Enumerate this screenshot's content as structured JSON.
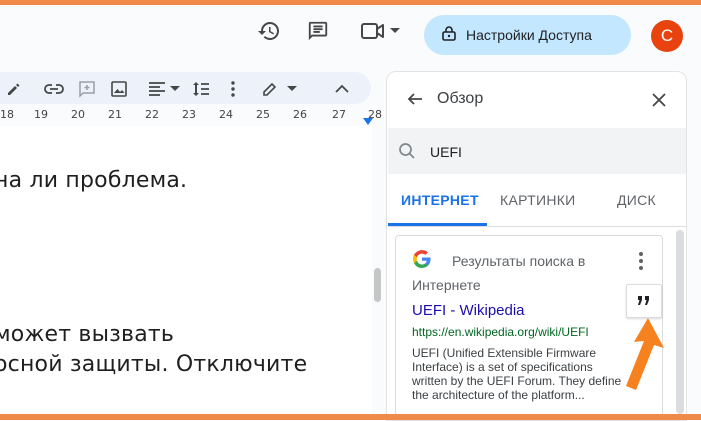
{
  "header": {
    "share_label": "Настройки Доступа",
    "avatar_letter": "C",
    "icons": [
      "history-icon",
      "comment-icon",
      "video-call-icon",
      "chevron-down-icon",
      "lock-icon"
    ]
  },
  "toolbar": {
    "icons": [
      "highlight-pen-icon",
      "link-icon",
      "add-comment-icon",
      "image-icon",
      "align-left-icon",
      "chevron-down-icon",
      "line-spacing-icon",
      "more-vert-icon",
      "edit-mode-icon",
      "chevron-down-icon",
      "chevron-up-icon"
    ]
  },
  "ruler": {
    "labels": [
      "18",
      "19",
      "20",
      "21",
      "22",
      "23",
      "24",
      "25",
      "26",
      "27",
      "28"
    ]
  },
  "document": {
    "lines": [
      "на ли проблема.",
      "может вызвать",
      "осной защиты. Отключите"
    ]
  },
  "panel": {
    "title": "Обзор",
    "search_value": "UEFI",
    "tabs": [
      {
        "label": "ИНТЕРНЕТ",
        "active": true
      },
      {
        "label": "КАРТИНКИ",
        "active": false
      },
      {
        "label": "ДИСК",
        "active": false
      }
    ],
    "card": {
      "heading_line1": "Результаты поиска в",
      "heading_line2": "Интернете",
      "result_title": "UEFI - Wikipedia",
      "result_url": "https://en.wikipedia.org/wiki/UEFI",
      "result_snippet": "UEFI (Unified Extensible Firmware Interface) is a set of specifications written by the UEFI Forum. They define the architecture of the platform..."
    }
  },
  "colors": {
    "accent": "#1a73e8",
    "share_bg": "#c2e7ff",
    "avatar_bg": "#e8430f",
    "frame": "#f08a4b",
    "link": "#1a0dab",
    "url": "#006621"
  }
}
